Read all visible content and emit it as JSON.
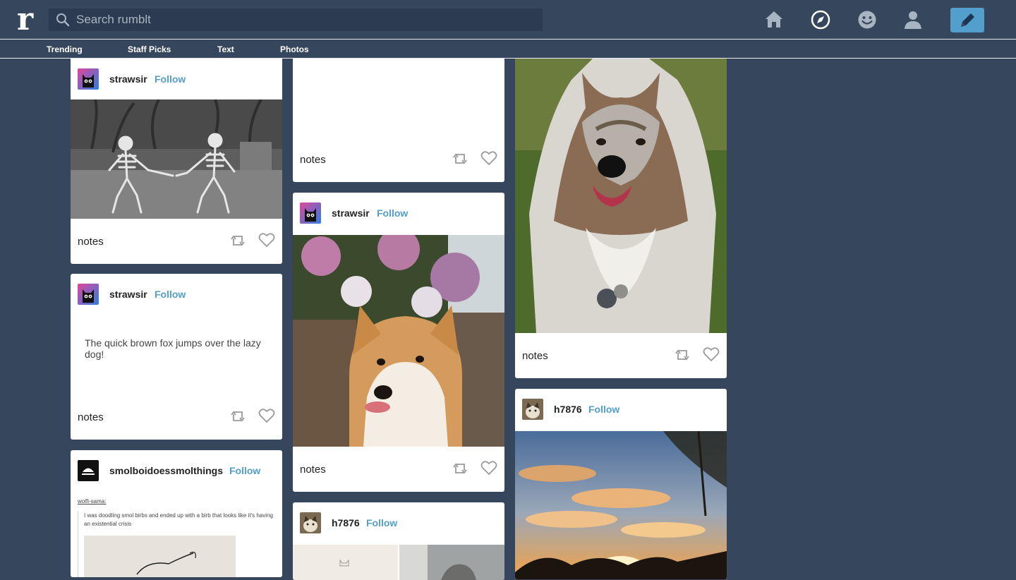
{
  "app": {
    "logo_letter": "r"
  },
  "search": {
    "placeholder": "Search rumblt"
  },
  "nav": {
    "icons": [
      "home-icon",
      "explore-compass-icon",
      "smiley-icon",
      "account-person-icon",
      "compose-pencil-icon"
    ]
  },
  "subnav": {
    "trending": "Trending",
    "staff_picks": "Staff Picks",
    "text": "Text",
    "photos": "Photos"
  },
  "colors": {
    "background": "#36465d",
    "accent": "#529ecc",
    "card": "#ffffff"
  },
  "posts": [
    {
      "user": "strawsir",
      "follow": "Follow",
      "type": "photo",
      "image": "dancing skeletons cartoon",
      "notes": "notes"
    },
    {
      "user": "strawsir",
      "follow": "Follow",
      "type": "text",
      "body": "The quick brown fox jumps over the lazy dog!",
      "notes": "notes"
    },
    {
      "user": "smolboidoessmolthings",
      "follow": "Follow",
      "type": "text",
      "reblog_from": "wolfi-sama:",
      "quote": "I was doodling smol birbs and ended up with a birb that looks like it's having an existential crisis",
      "image": "bird doodle sketch"
    },
    {
      "notes": "notes"
    },
    {
      "user": "strawsir",
      "follow": "Follow",
      "type": "photo",
      "image": "shiba inu with tongue out",
      "notes": "notes"
    },
    {
      "user": "h7876",
      "follow": "Follow",
      "type": "photo",
      "image": "cats"
    },
    {
      "type": "photo",
      "image": "rough collie dog",
      "notes": "notes"
    },
    {
      "user": "h7876",
      "follow": "Follow",
      "type": "photo",
      "image": "sunset with clouds and trees"
    }
  ]
}
